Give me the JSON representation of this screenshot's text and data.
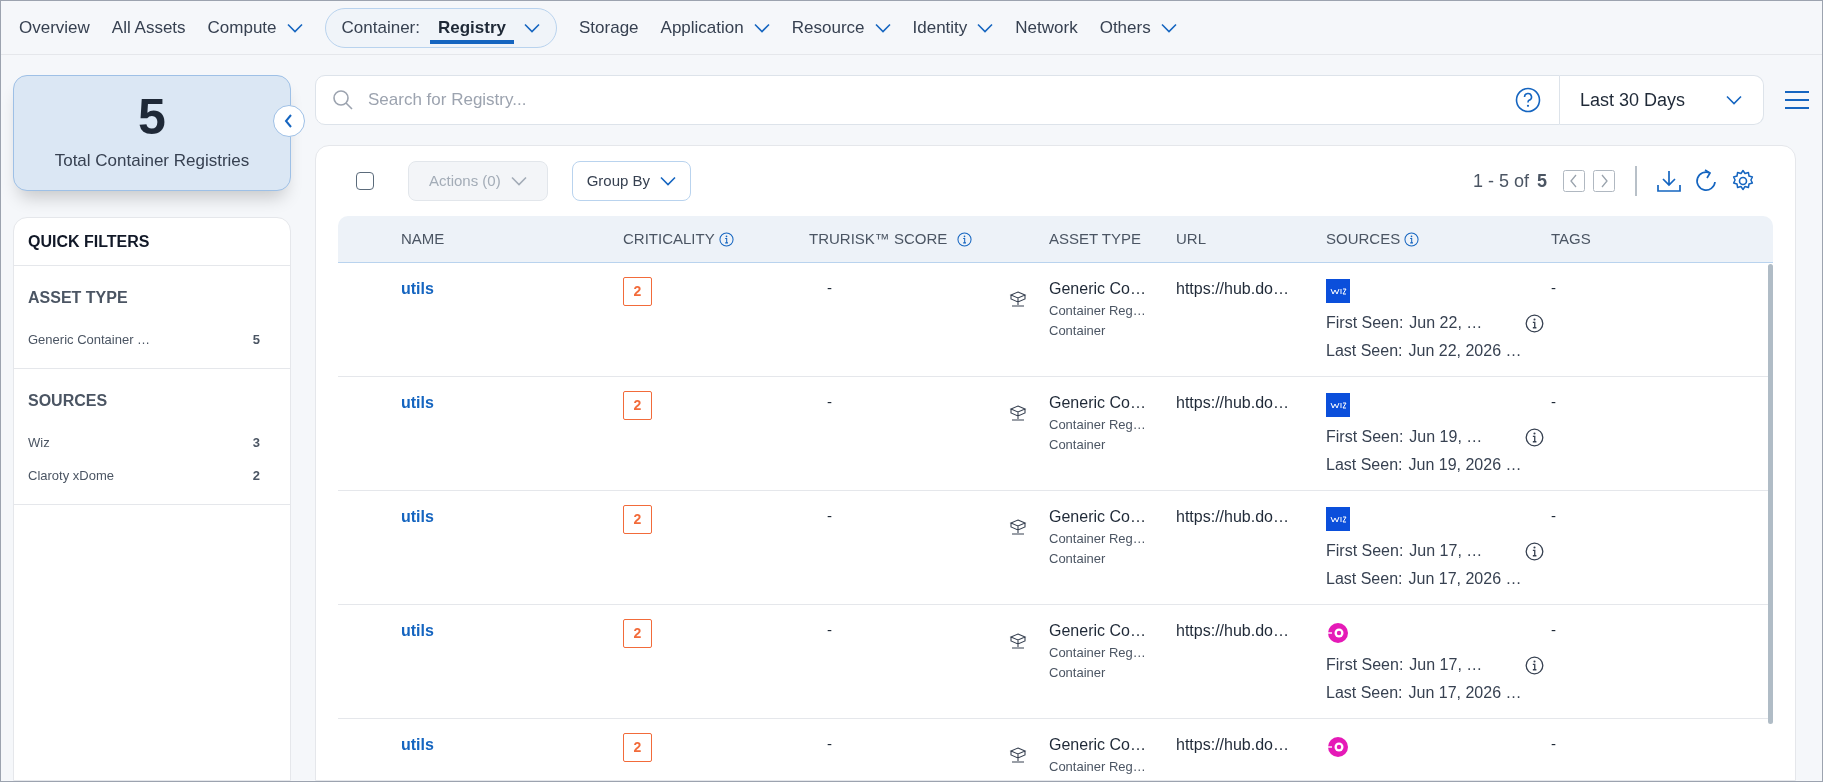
{
  "nav": [
    {
      "label": "Overview",
      "dropdown": false,
      "selected": false
    },
    {
      "label": "All Assets",
      "dropdown": false,
      "selected": false
    },
    {
      "label": "Compute",
      "dropdown": true,
      "selected": false
    },
    {
      "prefix": "Container:",
      "label": "Registry",
      "dropdown": true,
      "selected": true
    },
    {
      "label": "Storage",
      "dropdown": false,
      "selected": false
    },
    {
      "label": "Application",
      "dropdown": true,
      "selected": false
    },
    {
      "label": "Resource",
      "dropdown": true,
      "selected": false
    },
    {
      "label": "Identity",
      "dropdown": true,
      "selected": false
    },
    {
      "label": "Network",
      "dropdown": false,
      "selected": false
    },
    {
      "label": "Others",
      "dropdown": true,
      "selected": false
    }
  ],
  "summary": {
    "count": "5",
    "label": "Total Container Registries"
  },
  "quick_filters": {
    "title": "QUICK FILTERS",
    "groups": [
      {
        "title": "ASSET TYPE",
        "items": [
          {
            "label": "Generic Container …",
            "count": "5"
          }
        ]
      },
      {
        "title": "SOURCES",
        "items": [
          {
            "label": "Wiz",
            "count": "3"
          },
          {
            "label": "Claroty xDome",
            "count": "2"
          }
        ]
      }
    ]
  },
  "search": {
    "placeholder": "Search for Registry..."
  },
  "date_range": "Last 30 Days",
  "toolbar": {
    "actions": "Actions (0)",
    "actions_disabled": true,
    "group_by": "Group By",
    "select_all": false,
    "range": "1 - 5 of",
    "total": "5"
  },
  "table": {
    "columns": [
      {
        "label": "NAME",
        "kind": "plain"
      },
      {
        "label": "CRITICALITY",
        "kind": "info"
      },
      {
        "label": "TRURISK™ SCORE",
        "kind": "info"
      },
      {
        "label": "ASSET TYPE",
        "kind": "plain"
      },
      {
        "label": "URL",
        "kind": "plain"
      },
      {
        "label": "SOURCES",
        "kind": "info"
      },
      {
        "label": "TAGS",
        "kind": "plain"
      }
    ],
    "rows": [
      {
        "name": "utils",
        "criticality": "2",
        "trurisk": "-",
        "asset_type": [
          "Generic Co…",
          "Container Reg…",
          "Container"
        ],
        "url": "https://hub.do…",
        "kind": "wiz",
        "first_seen_label": "First Seen:",
        "first_seen": "Jun 22, …",
        "last_seen_label": "Last Seen:",
        "last_seen": "Jun 22, 2026 …",
        "tags": "-"
      },
      {
        "name": "utils",
        "criticality": "2",
        "trurisk": "-",
        "asset_type": [
          "Generic Co…",
          "Container Reg…",
          "Container"
        ],
        "url": "https://hub.do…",
        "kind": "wiz",
        "first_seen_label": "First Seen:",
        "first_seen": "Jun 19, …",
        "last_seen_label": "Last Seen:",
        "last_seen": "Jun 19, 2026 …",
        "tags": "-"
      },
      {
        "name": "utils",
        "criticality": "2",
        "trurisk": "-",
        "asset_type": [
          "Generic Co…",
          "Container Reg…",
          "Container"
        ],
        "url": "https://hub.do…",
        "kind": "wiz",
        "first_seen_label": "First Seen:",
        "first_seen": "Jun 17, …",
        "last_seen_label": "Last Seen:",
        "last_seen": "Jun 17, 2026 …",
        "tags": "-"
      },
      {
        "name": "utils",
        "criticality": "2",
        "trurisk": "-",
        "asset_type": [
          "Generic Co…",
          "Container Reg…",
          "Container"
        ],
        "url": "https://hub.do…",
        "kind": "claroty",
        "first_seen_label": "First Seen:",
        "first_seen": "Jun 17, …",
        "last_seen_label": "Last Seen:",
        "last_seen": "Jun 17, 2026 …",
        "tags": "-"
      },
      {
        "name": "utils",
        "criticality": "2",
        "trurisk": "-",
        "asset_type": [
          "Generic Co…",
          "Container Reg…"
        ],
        "url": "https://hub.do…",
        "kind": "claroty",
        "tags": "-"
      }
    ]
  }
}
